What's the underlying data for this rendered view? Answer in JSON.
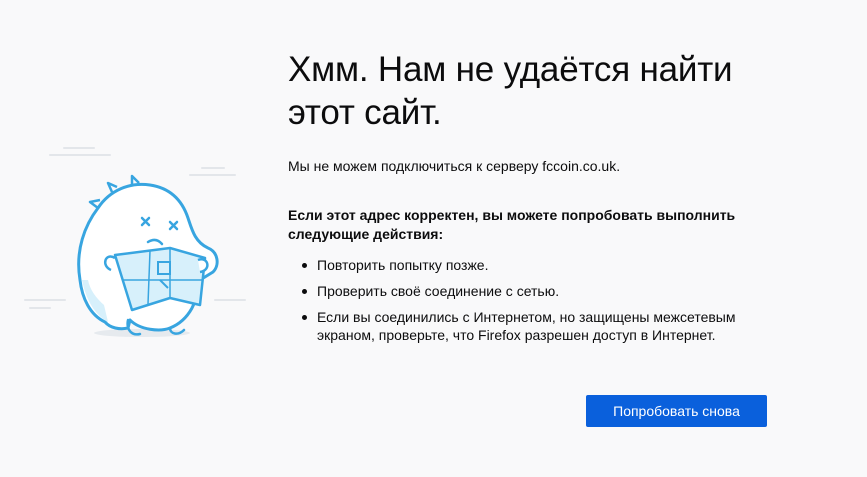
{
  "page": {
    "title": "Хмм. Нам не удаётся найти этот сайт.",
    "intro": "Мы не можем подключиться к серверу fccoin.co.uk.",
    "suggestions_heading": "Если этот адрес корректен, вы можете попробовать выполнить следующие действия:",
    "suggestions": [
      "Повторить попытку позже.",
      "Проверить своё соединение с сетью.",
      "Если вы соединились с Интернетом, но защищены межсетевым экраном, проверьте, что Firefox разрешен доступ в Интернет."
    ],
    "retry_label": "Попробовать снова"
  },
  "colors": {
    "background": "#f9f9fa",
    "button": "#0a60dc",
    "illustration_line": "#38a5e0",
    "illustration_fill": "#d7f0fb"
  },
  "icons": {
    "illustration": "lost-dino-with-map"
  }
}
